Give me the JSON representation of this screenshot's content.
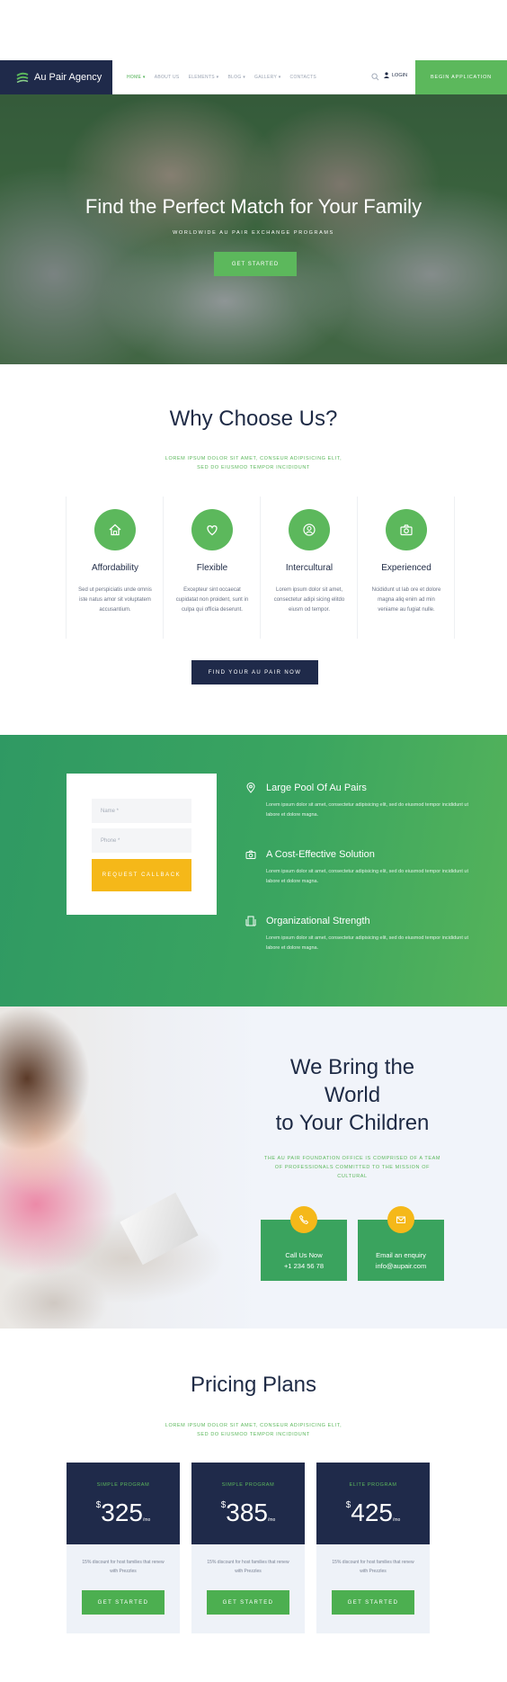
{
  "header": {
    "logo_text": "Au Pair Agency",
    "nav": [
      "HOME ▾",
      "ABOUT US",
      "ELEMENTS ▾",
      "BLOG ▾",
      "GALLERY ▾",
      "CONTACTS"
    ],
    "login": "LOGIN",
    "cta": "BEGIN APPLICATION"
  },
  "hero": {
    "title": "Find the Perfect Match for Your Family",
    "subtitle": "WORLDWIDE AU PAIR EXCHANGE PROGRAMS",
    "button": "GET STARTED"
  },
  "why": {
    "title": "Why Choose Us?",
    "subtitle": "LOREM IPSUM DOLOR SIT AMET, CONSEUR ADIPISICING ELIT, SED DO EIUSMOD TEMPOR INCIDIDUNT",
    "features": [
      {
        "icon": "home-icon",
        "title": "Affordability",
        "text": "Sed ut perspiciatis unde omnis iste natus amor sit voluptatem accusantium."
      },
      {
        "icon": "heart-icon",
        "title": "Flexible",
        "text": "Excepteur sint occaecat cupidatat non proident, sunt in culpa qui officia deserunt."
      },
      {
        "icon": "user-icon",
        "title": "Intercultural",
        "text": "Lorem ipsum dolor sit amet, consectetur adipi sicing elitdo eiusm od tempor."
      },
      {
        "icon": "camera-icon",
        "title": "Experienced",
        "text": "Ncididunt ut lab ore et dolore magna aliq enim ad min veniame au fugiat nulle."
      }
    ],
    "button": "FIND YOUR AU PAIR NOW"
  },
  "callback": {
    "name_placeholder": "Name *",
    "phone_placeholder": "Phone *",
    "button": "REQUEST CALLBACK",
    "items": [
      {
        "icon": "location-pin-icon",
        "title": "Large Pool Of Au Pairs",
        "text": "Lorem ipsum dolor sit amet, consectetur adipisicing elit, sed do eiusmod tempor incididunt ut labore et dolore magna."
      },
      {
        "icon": "camera-icon",
        "title": "A Cost-Effective Solution",
        "text": "Lorem ipsum dolor sit amet, consectetur adipisicing elit, sed do eiusmod tempor incididunt ut labore et dolore magna."
      },
      {
        "icon": "building-icon",
        "title": "Organizational Strength",
        "text": "Lorem ipsum dolor sit amet, consectetur adipisicing elit, sed do eiusmod tempor incididunt ut labore et dolore magna."
      }
    ]
  },
  "children": {
    "title_lines": [
      "We Bring the",
      "World",
      "to Your Children"
    ],
    "subtitle": "THE AU PAIR FOUNDATION OFFICE IS COMPRISED OF A TEAM OF PROFESSIONALS COMMITTED TO THE MISSION OF CULTURAL",
    "contacts": [
      {
        "icon": "phone-icon",
        "label": "Call Us Now",
        "value": "+1 234 56 78"
      },
      {
        "icon": "mail-icon",
        "label": "Email an enquiry",
        "value": "info@aupair.com"
      }
    ]
  },
  "pricing": {
    "title": "Pricing Plans",
    "subtitle": "LOREM IPSUM DOLOR SIT AMET, CONSEUR ADIPISICING ELIT, SED DO EIUSMOD TEMPOR INCIDIDUNT",
    "plans": [
      {
        "name": "SIMPLE PROGRAM",
        "currency": "$",
        "amount": "325",
        "period": "/mo",
        "text": "15% discount for host families that renew with Prezzles",
        "button": "GET STARTED"
      },
      {
        "name": "SIMPLE PROGRAM",
        "currency": "$",
        "amount": "385",
        "period": "/mo",
        "text": "15% discount for host families that renew with Prezzles",
        "button": "GET STARTED"
      },
      {
        "name": "ELITE PROGRAM",
        "currency": "$",
        "amount": "425",
        "period": "/mo",
        "text": "15% discount for host families that renew with Prezzles",
        "button": "GET STARTED"
      }
    ]
  },
  "colors": {
    "brand_green": "#5cb85c",
    "navy": "#1f2a4a",
    "accent_yellow": "#f5b819"
  }
}
